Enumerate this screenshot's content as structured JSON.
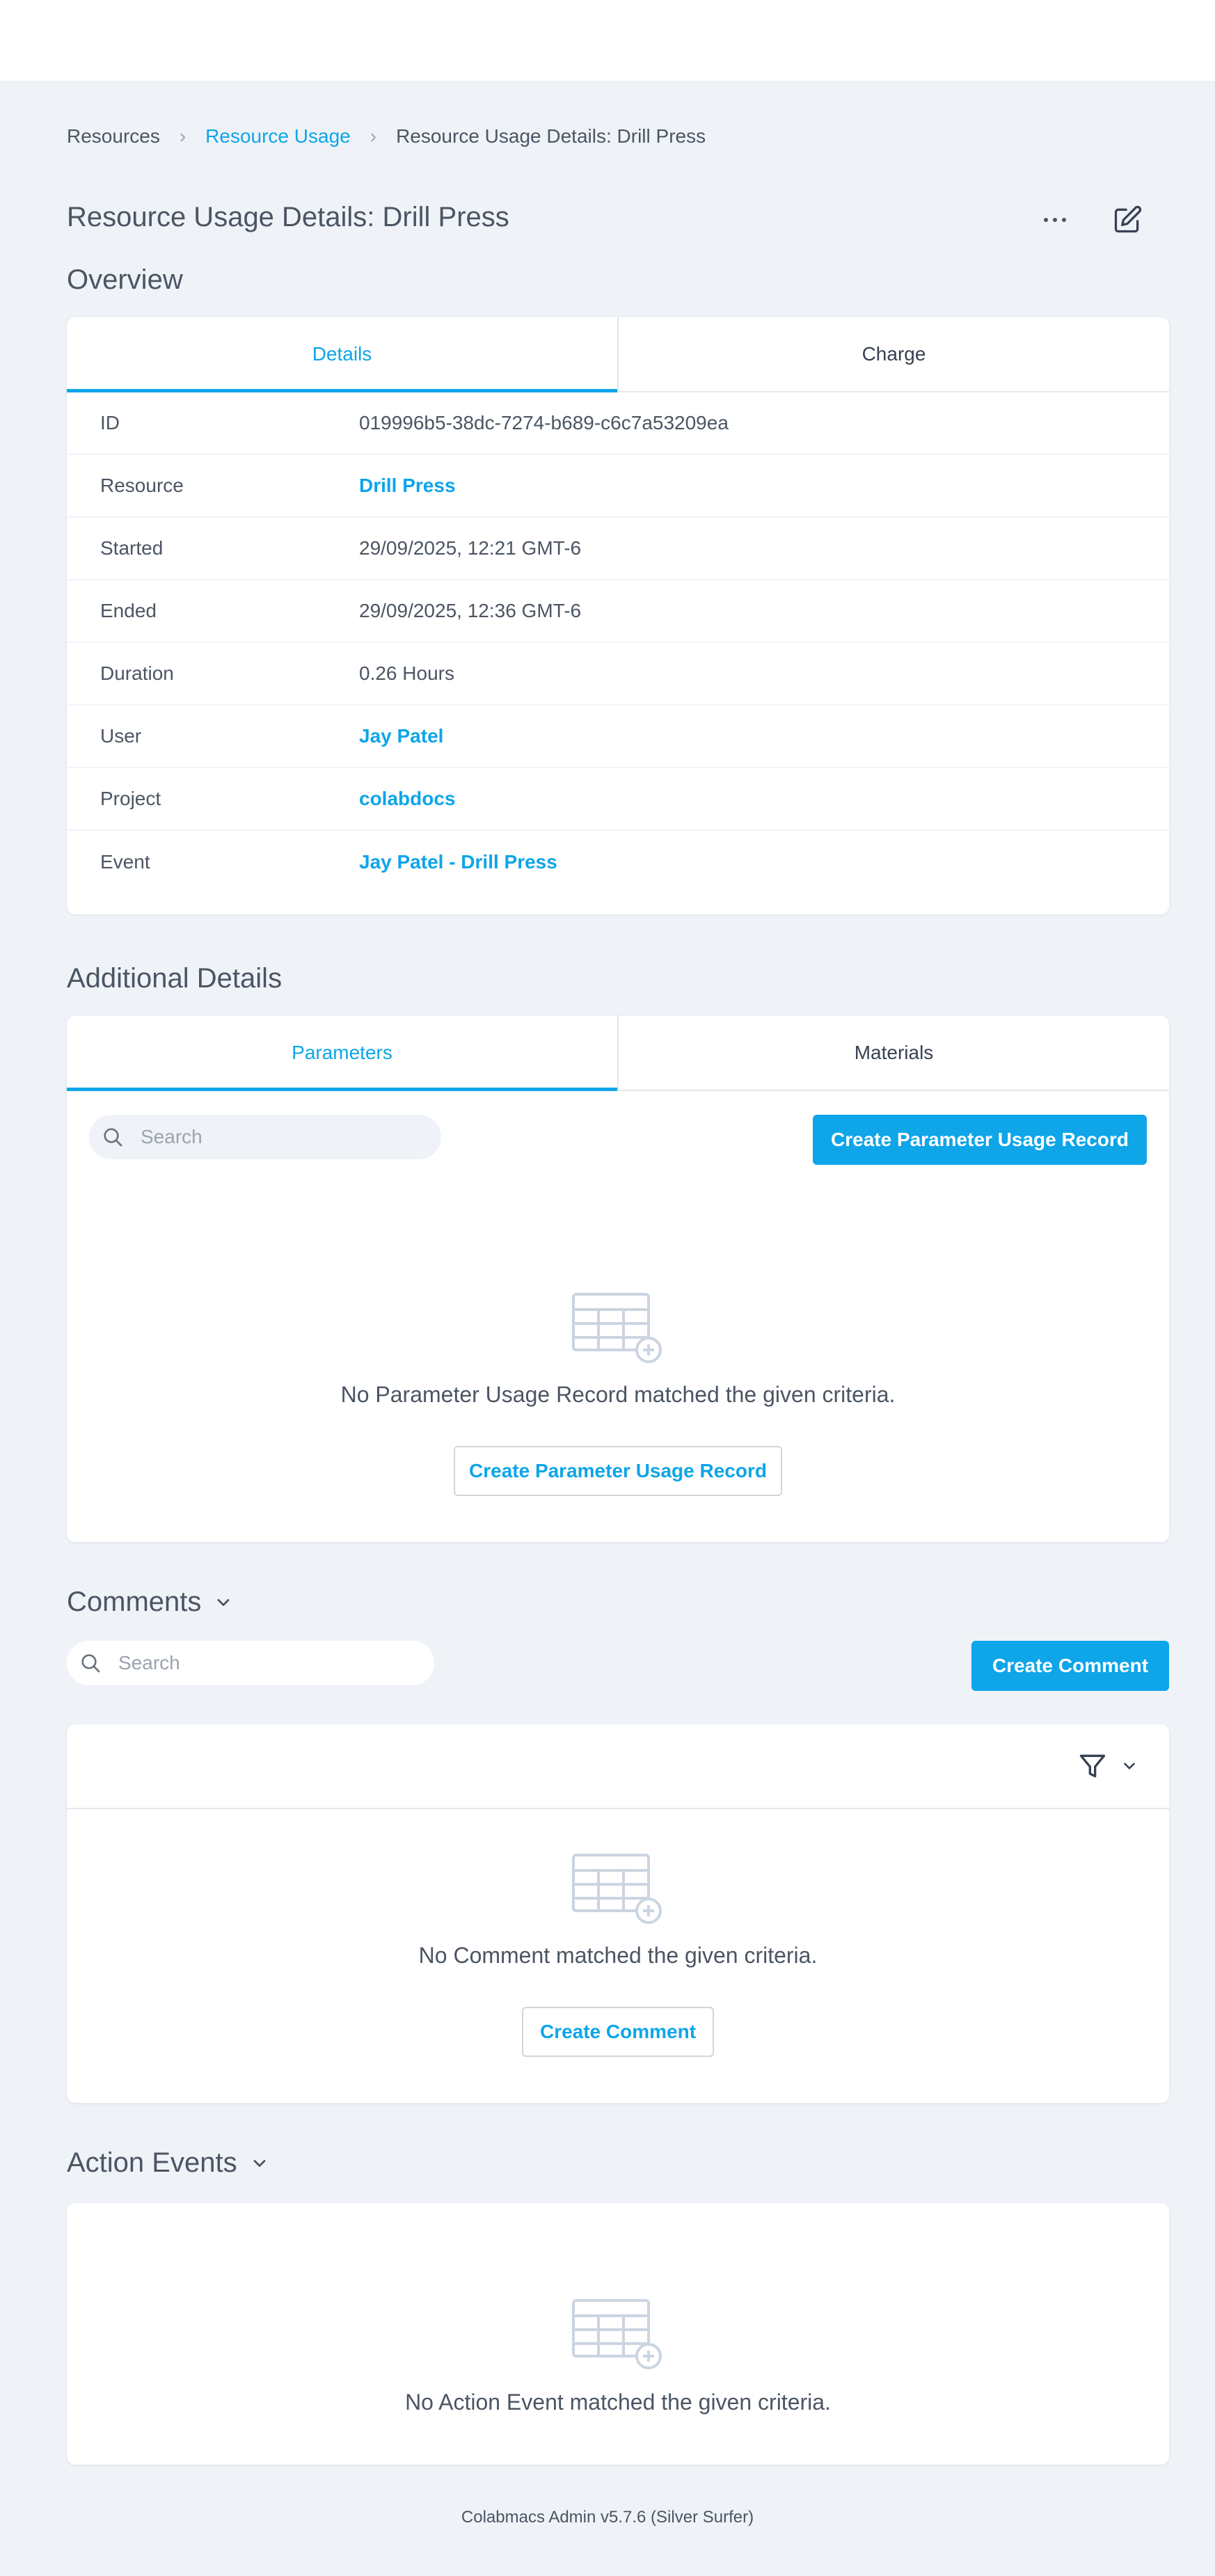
{
  "breadcrumb": {
    "items": [
      "Resources",
      "Resource Usage",
      "Resource Usage Details: Drill Press"
    ]
  },
  "page": {
    "title": "Resource Usage Details: Drill Press"
  },
  "overview": {
    "section_title": "Overview",
    "tabs": [
      {
        "label": "Details",
        "active": true
      },
      {
        "label": "Charge",
        "active": false
      }
    ],
    "rows": [
      {
        "label": "ID",
        "value": "019996b5-38dc-7274-b689-c6c7a53209ea",
        "link": false
      },
      {
        "label": "Resource",
        "value": "Drill Press",
        "link": true
      },
      {
        "label": "Started",
        "value": "29/09/2025, 12:21 GMT-6",
        "link": false
      },
      {
        "label": "Ended",
        "value": "29/09/2025, 12:36 GMT-6",
        "link": false
      },
      {
        "label": "Duration",
        "value": "0.26 Hours",
        "link": false
      },
      {
        "label": "User",
        "value": "Jay Patel",
        "link": true
      },
      {
        "label": "Project",
        "value": "colabdocs",
        "link": true
      },
      {
        "label": "Event",
        "value": "Jay Patel - Drill Press",
        "link": true
      }
    ]
  },
  "additional": {
    "section_title": "Additional Details",
    "tabs": [
      {
        "label": "Parameters",
        "active": true
      },
      {
        "label": "Materials",
        "active": false
      }
    ],
    "search_placeholder": "Search",
    "create_button": "Create Parameter Usage Record",
    "empty_text": "No Parameter Usage Record matched the given criteria.",
    "empty_button": "Create Parameter Usage Record"
  },
  "comments": {
    "section_title": "Comments",
    "search_placeholder": "Search",
    "create_button": "Create Comment",
    "empty_text": "No Comment matched the given criteria.",
    "empty_button": "Create Comment"
  },
  "action_events": {
    "section_title": "Action Events",
    "empty_text": "No Action Event matched the given criteria."
  },
  "footer": {
    "text": "Colabmacs Admin v5.7.6 (Silver Surfer)"
  },
  "colors": {
    "accent": "#0ea5e9",
    "background": "#eff3f8",
    "text": "#4b5563"
  },
  "icons": {
    "breadcrumb_separator": "chevron-right-icon",
    "more": "more-horizontal-icon",
    "edit": "edit-icon",
    "search": "search-icon",
    "collapse": "chevron-down-icon",
    "filter": "filter-icon",
    "empty_state": "table-add-icon"
  }
}
